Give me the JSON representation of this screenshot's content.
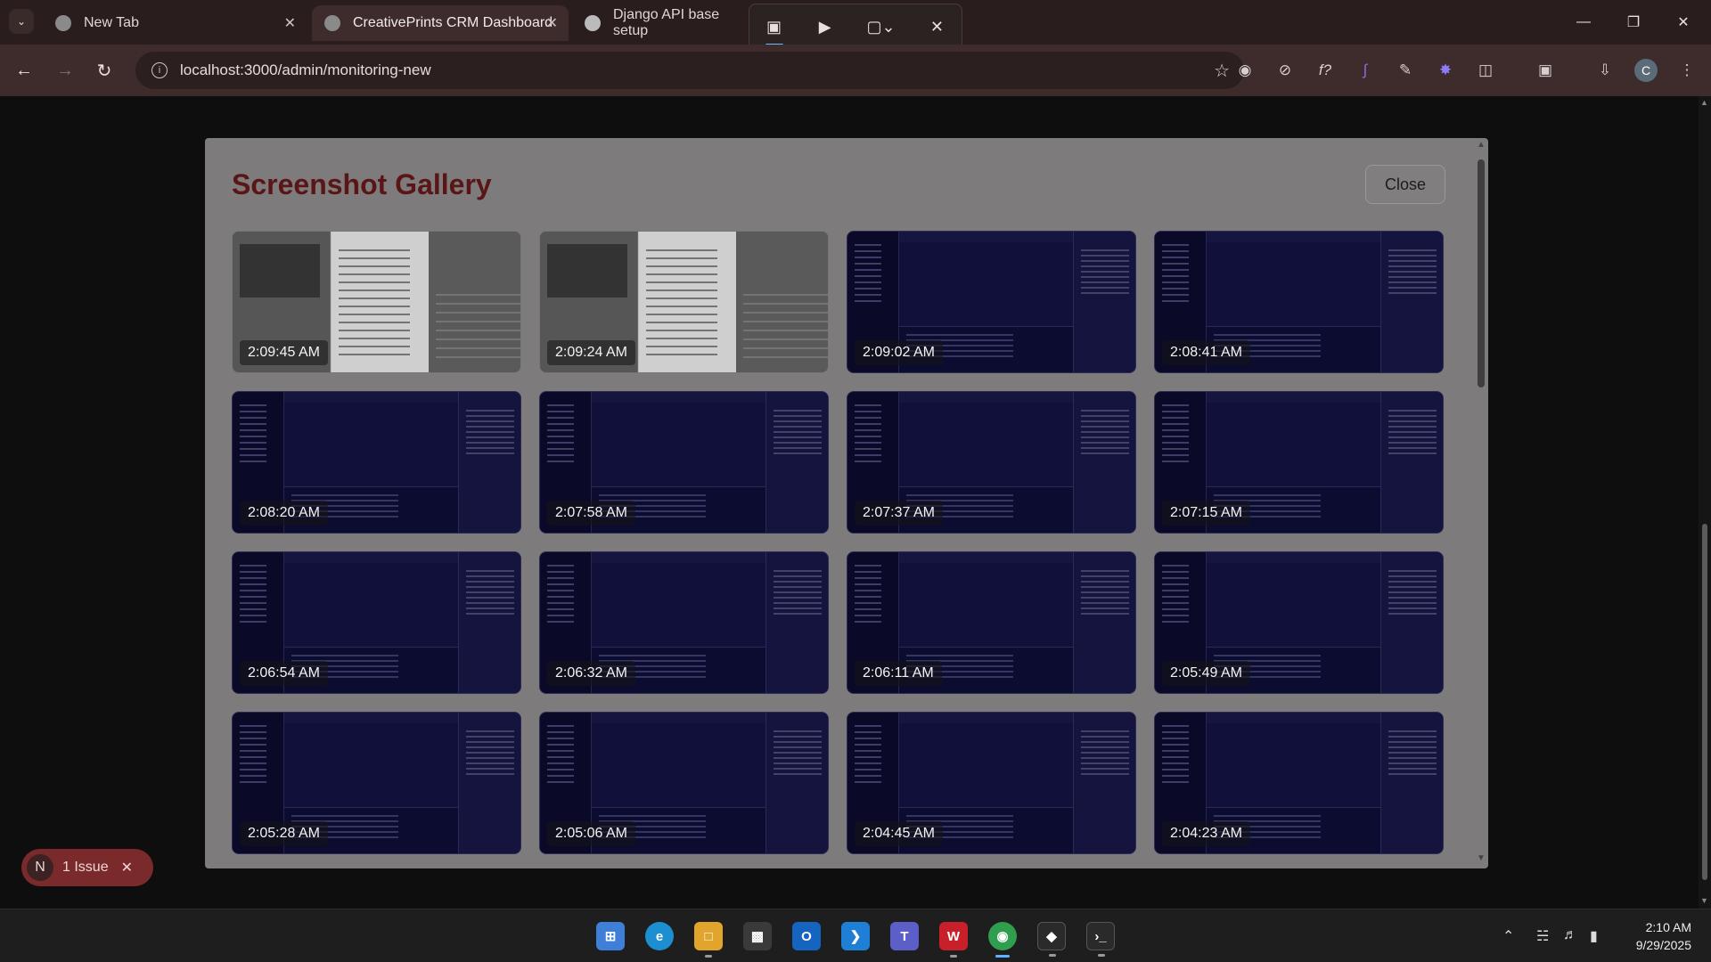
{
  "browser": {
    "tabs": [
      {
        "title": "New Tab",
        "favicon_color": "#8a8a8a",
        "active": false
      },
      {
        "title": "CreativePrints CRM Dashboard",
        "favicon_color": "#8a8a8a",
        "active": true
      },
      {
        "title": "Django API base setup",
        "favicon_color": "#bbbbbb",
        "active": false
      }
    ],
    "url": "localhost:3000/admin/monitoring-new",
    "profile_initial": "C"
  },
  "modal": {
    "title": "Screenshot Gallery",
    "close_label": "Close",
    "screenshots": [
      {
        "time": "2:09:45 AM",
        "theme": "light"
      },
      {
        "time": "2:09:24 AM",
        "theme": "light"
      },
      {
        "time": "2:09:02 AM",
        "theme": "dark"
      },
      {
        "time": "2:08:41 AM",
        "theme": "dark"
      },
      {
        "time": "2:08:20 AM",
        "theme": "dark"
      },
      {
        "time": "2:07:58 AM",
        "theme": "dark"
      },
      {
        "time": "2:07:37 AM",
        "theme": "dark"
      },
      {
        "time": "2:07:15 AM",
        "theme": "dark"
      },
      {
        "time": "2:06:54 AM",
        "theme": "dark"
      },
      {
        "time": "2:06:32 AM",
        "theme": "dark"
      },
      {
        "time": "2:06:11 AM",
        "theme": "dark"
      },
      {
        "time": "2:05:49 AM",
        "theme": "dark"
      },
      {
        "time": "2:05:28 AM",
        "theme": "dark"
      },
      {
        "time": "2:05:06 AM",
        "theme": "dark"
      },
      {
        "time": "2:04:45 AM",
        "theme": "dark"
      },
      {
        "time": "2:04:23 AM",
        "theme": "dark"
      }
    ]
  },
  "issue_badge": {
    "initial": "N",
    "label": "1 Issue"
  },
  "taskbar": {
    "time": "2:10 AM",
    "date": "9/29/2025"
  },
  "colors": {
    "modal_title": "#5a1616",
    "accent_blue": "#5fb2ff",
    "issue_badge": "#7a2a2a"
  }
}
